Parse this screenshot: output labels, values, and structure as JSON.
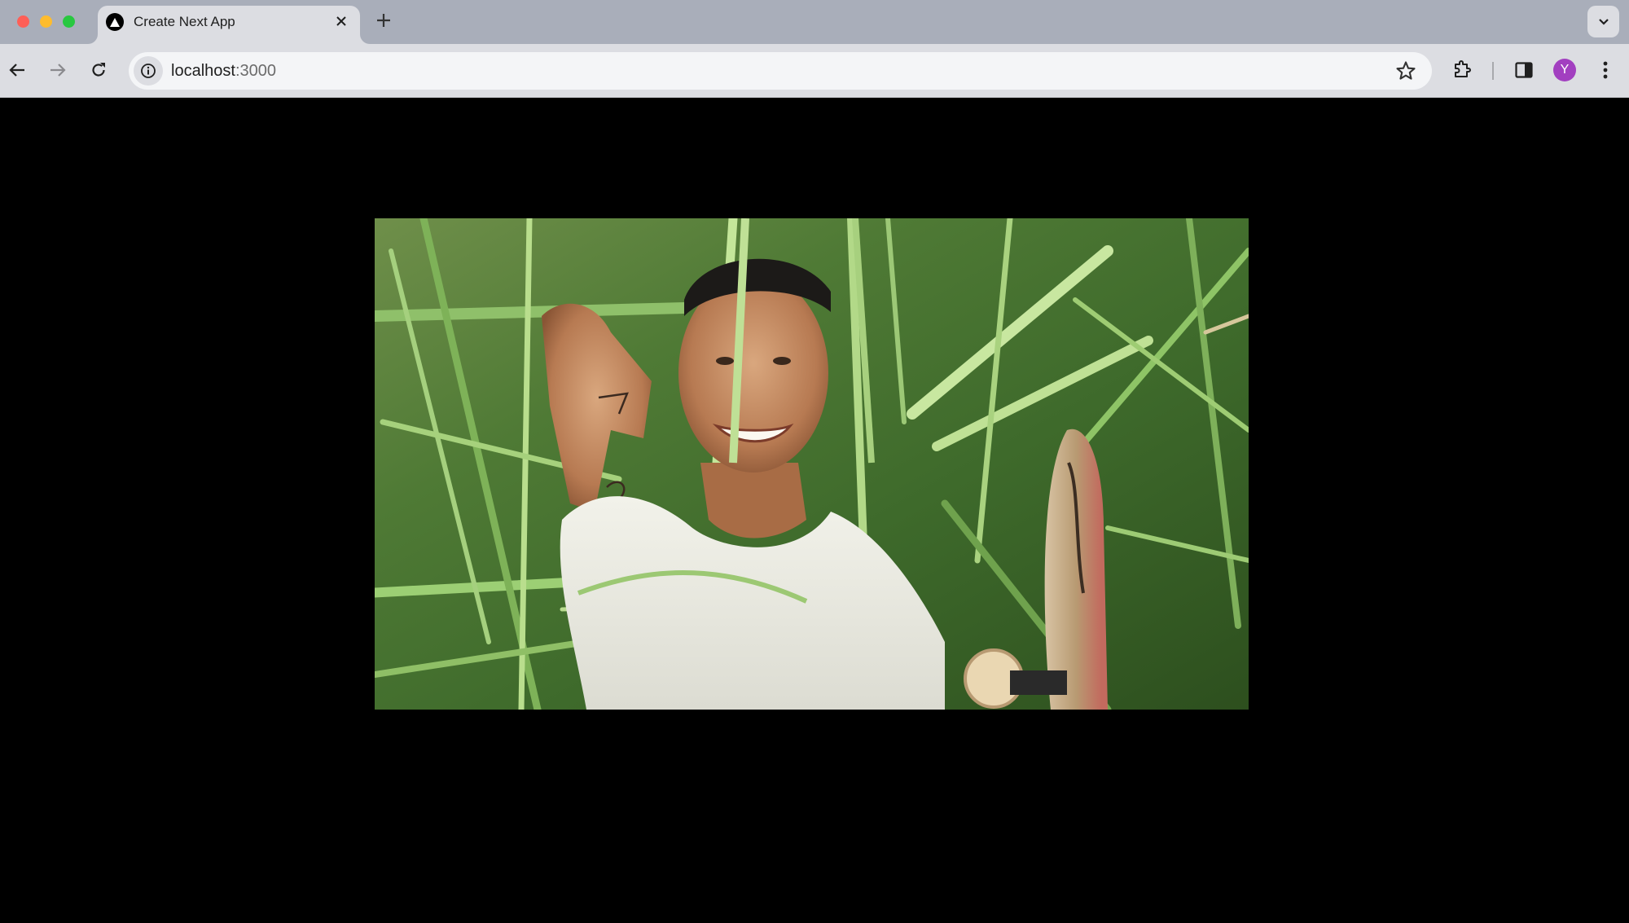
{
  "browser": {
    "tab": {
      "title": "Create Next App",
      "favicon": "nextjs-triangle-icon",
      "close_icon": "close-icon"
    },
    "new_tab_icon": "plus-icon",
    "tab_search_icon": "chevron-down-icon",
    "toolbar": {
      "back_icon": "arrow-left-icon",
      "forward_icon": "arrow-right-icon",
      "reload_icon": "reload-icon",
      "site_info_icon": "info-icon",
      "url_host": "localhost",
      "url_port": ":3000",
      "bookmark_icon": "star-icon",
      "extensions_icon": "puzzle-icon",
      "side_panel_icon": "side-panel-icon",
      "profile_initial": "Y",
      "profile_color": "#a23fc0",
      "menu_icon": "kebab-menu-icon"
    }
  },
  "page": {
    "background": "#000000",
    "hero_image": {
      "alt": "Smiling person lying in tall green grass wearing a white t-shirt, with a skateboard beside them"
    }
  }
}
